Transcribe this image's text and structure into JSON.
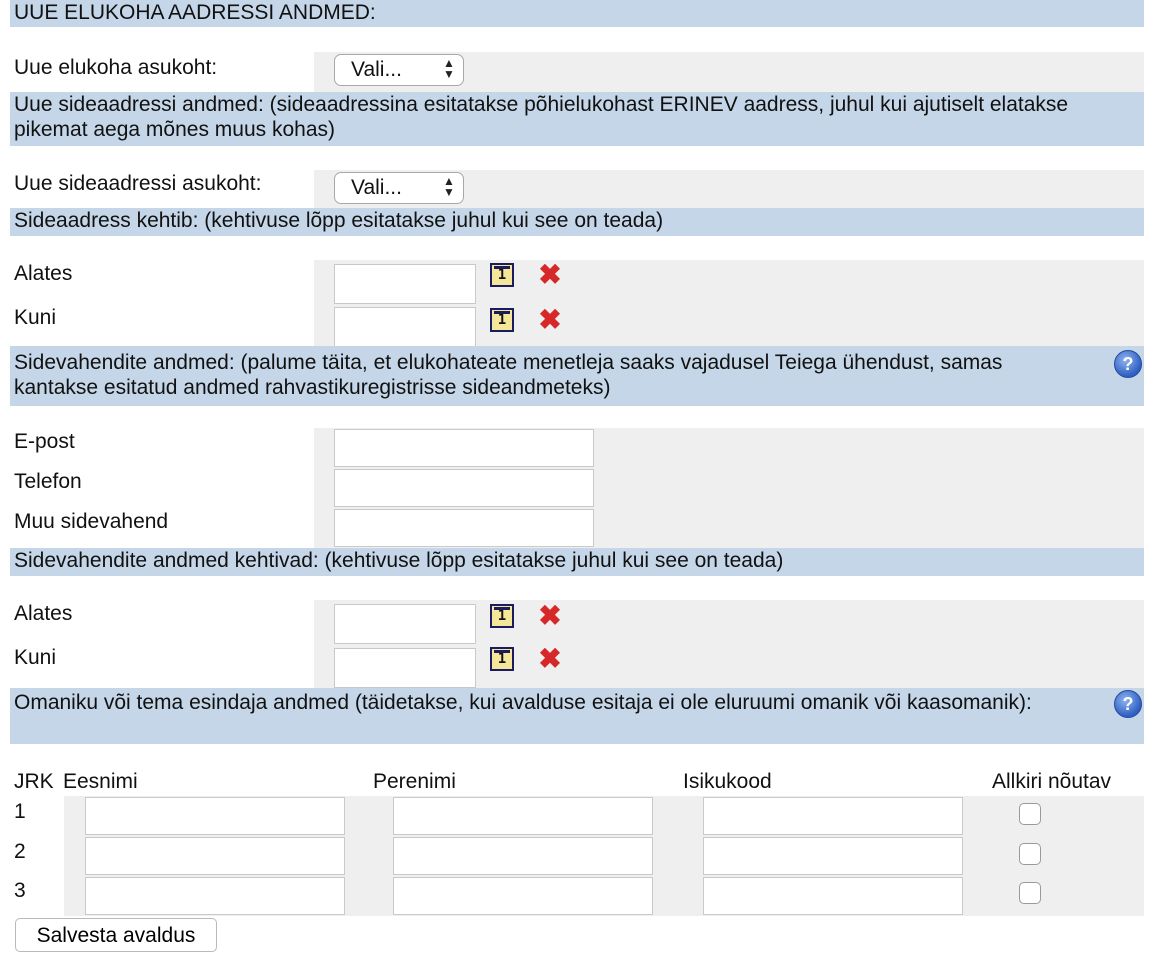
{
  "section_new_address": {
    "title": "UUE ELUKOHA AADRESSI ANDMED:",
    "location_label": "Uue elukoha asukoht:",
    "location_select": "Vali..."
  },
  "contact_address": {
    "info": "Uue sideaadressi andmed: (sideaadressina esitatakse põhielukohast ERINEV aadress, juhul kui ajutiselt elatakse pikemat aega mõnes muus kohas)",
    "location_label": "Uue sideaadressi asukoht:",
    "location_select": "Vali...",
    "validity_info": "Sideaadress kehtib: (kehtivuse lõpp esitatakse juhul kui see on teada)",
    "from_label": "Alates",
    "to_label": "Kuni"
  },
  "contact_means": {
    "info": "Sidevahendite andmed: (palume täita, et elukohateate menetleja saaks vajadusel Teiega ühendust, samas kantakse esitatud andmed rahvastikuregistrisse sideandmeteks)",
    "email_label": "E-post",
    "phone_label": "Telefon",
    "other_label": "Muu sidevahend",
    "validity_info": "Sidevahendite andmed kehtivad: (kehtivuse lõpp esitatakse juhul kui see on teada)",
    "from_label": "Alates",
    "to_label": "Kuni"
  },
  "owners": {
    "info": "Omaniku või tema esindaja andmed (täidetakse, kui avalduse esitaja ei ole eluruumi omanik või kaasomanik):",
    "columns": [
      "JRK",
      "Eesnimi",
      "Perenimi",
      "Isikukood",
      "Allkiri nõutav"
    ],
    "rows": [
      {
        "num": "1"
      },
      {
        "num": "2"
      },
      {
        "num": "3"
      }
    ]
  },
  "icons": {
    "calendar": "calendar-icon",
    "clear": "delete-x-icon",
    "help": "help-icon",
    "calendar_glyph": "1",
    "clear_glyph": "✖",
    "help_glyph": "?"
  },
  "colors": {
    "band": "#c4d6e8",
    "row_grey": "#efefef",
    "clear_red": "#d62828"
  },
  "save_button": "Salvesta avaldus"
}
